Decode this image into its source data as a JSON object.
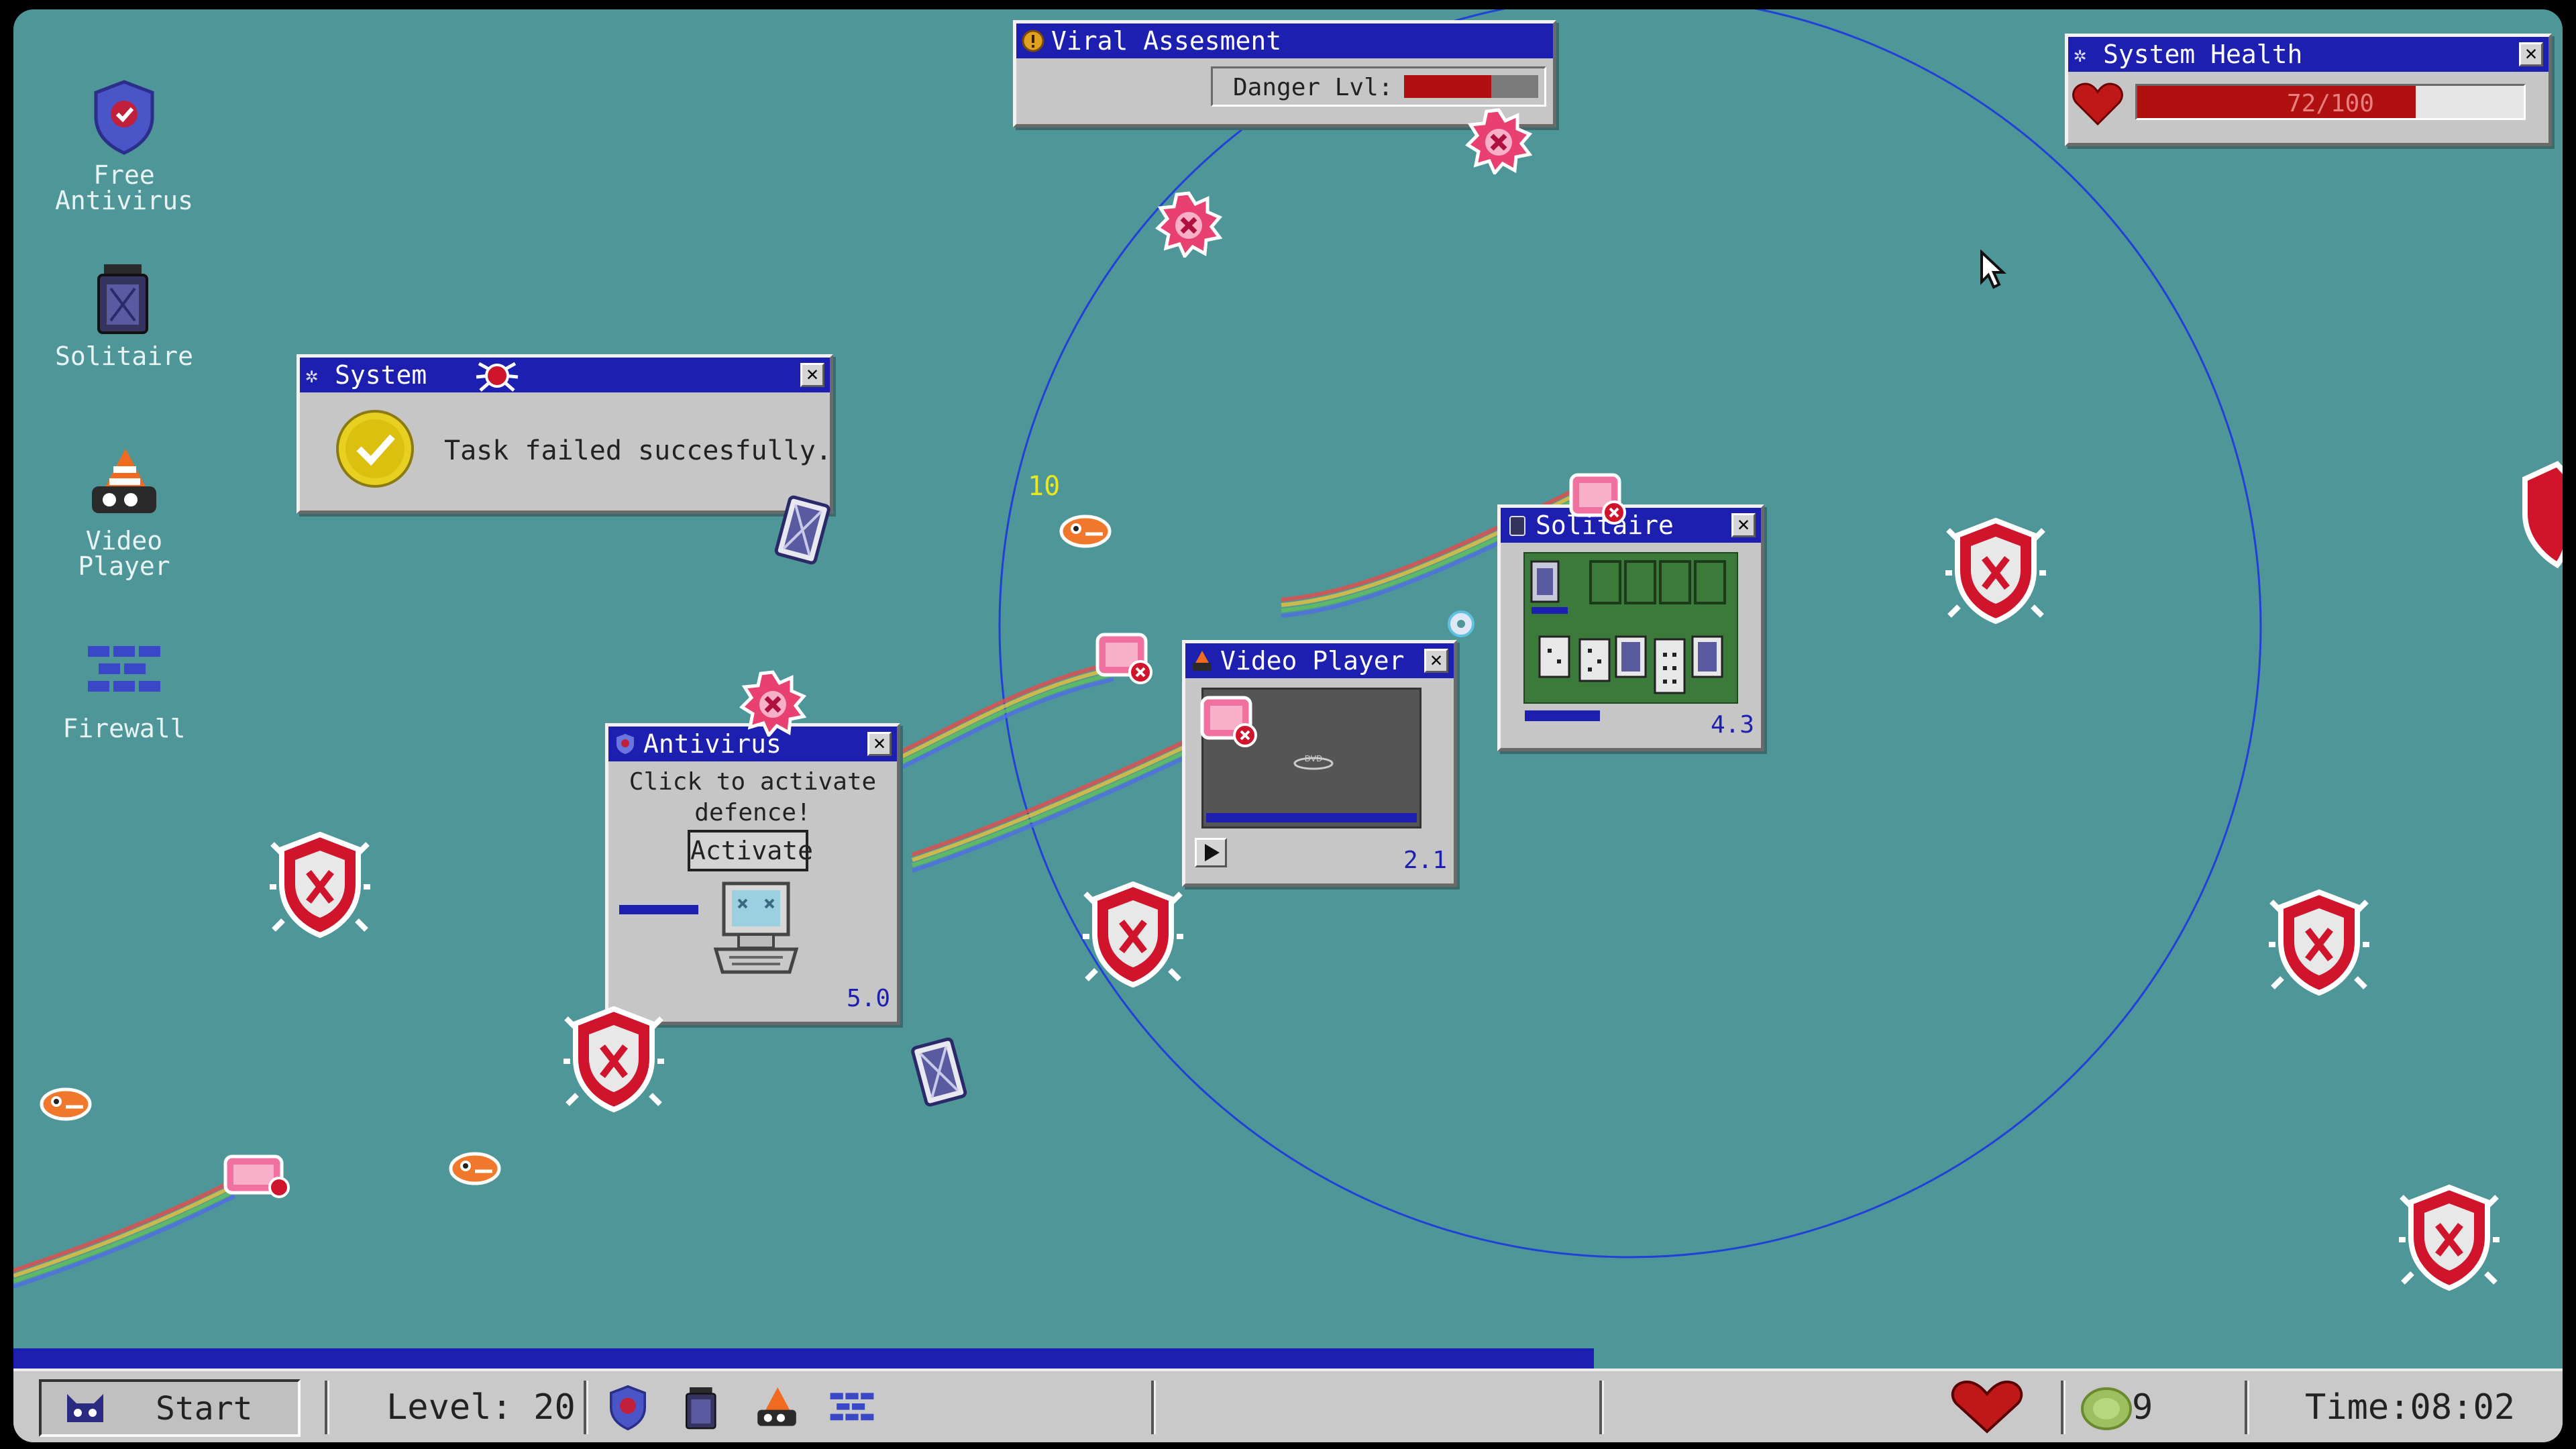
{
  "desktop_icons": [
    {
      "label": "Free Antivirus",
      "icon": "shield-icon"
    },
    {
      "label": "Solitaire",
      "icon": "solitaire-icon"
    },
    {
      "label": "Video Player",
      "icon": "video-player-icon"
    },
    {
      "label": "Firewall",
      "icon": "firewall-icon"
    }
  ],
  "viral_assessment": {
    "title": "Viral Assesment",
    "danger_label": "Danger Lvl:",
    "danger_level": 0.65
  },
  "system_health": {
    "title": "System Health",
    "value_text": "72/100",
    "value": 72,
    "max": 100
  },
  "system_dialog": {
    "title": "System",
    "message": "Task failed succesfully."
  },
  "antivirus_window": {
    "title": "Antivirus",
    "message": "Click to activate defence!",
    "button": "Activate",
    "value": "5.0"
  },
  "video_player_window": {
    "title": "Video Player",
    "value": "2.1"
  },
  "solitaire_window": {
    "title": "Solitaire",
    "value": "4.3"
  },
  "floating_number": "10",
  "taskbar": {
    "start": "Start",
    "level": "Level: 20",
    "coins": "9",
    "time": "Time:08:02",
    "progress": 0.62
  },
  "colors": {
    "desktop": "#4f9698",
    "titlebar": "#1c1fb0",
    "danger": "#c01818",
    "window": "#c6c6c6"
  }
}
